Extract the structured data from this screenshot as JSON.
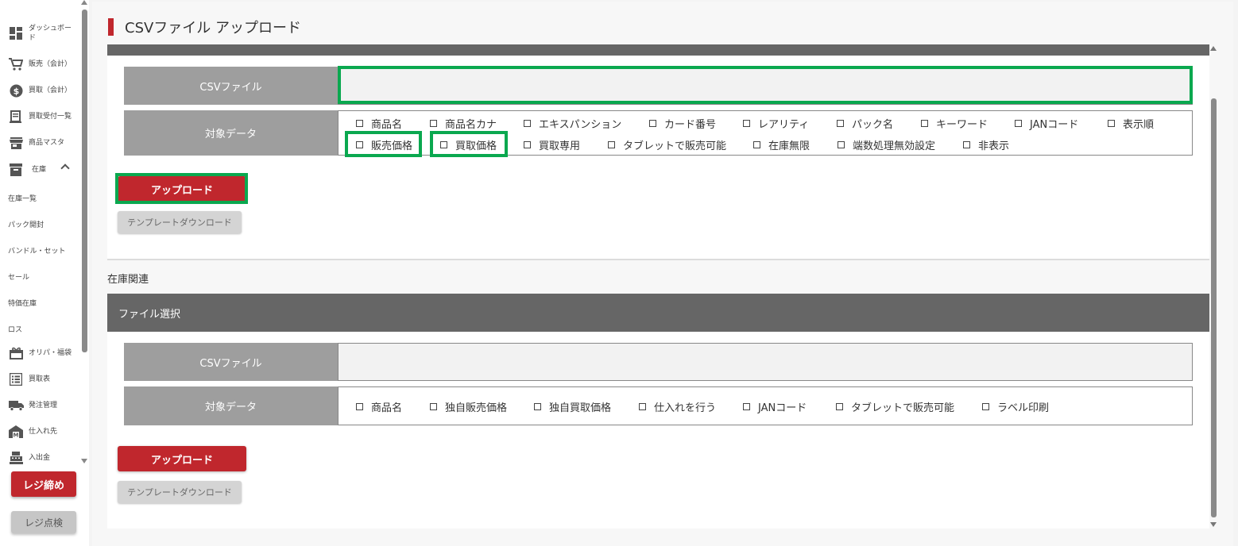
{
  "sidebar": {
    "items": [
      {
        "label": "ダッシュボード",
        "icon": "dashboard-icon"
      },
      {
        "label": "販売（会計）",
        "icon": "cart-icon"
      },
      {
        "label": "買取（会計）",
        "icon": "dollar-icon"
      },
      {
        "label": "買取受付一覧",
        "icon": "receipt-icon"
      },
      {
        "label": "商品マスタ",
        "icon": "store-icon"
      },
      {
        "label": "在庫",
        "icon": "archive-icon"
      },
      {
        "label": "オリパ・福袋",
        "icon": "gift-icon"
      },
      {
        "label": "買取表",
        "icon": "list-icon"
      },
      {
        "label": "発注管理",
        "icon": "truck-icon"
      },
      {
        "label": "仕入れ先",
        "icon": "warehouse-icon"
      },
      {
        "label": "入出金",
        "icon": "register-icon"
      }
    ],
    "subitems": [
      "在庫一覧",
      "パック開封",
      "バンドル・セット",
      "セール",
      "特価在庫",
      "ロス"
    ],
    "close_register": "レジ締め",
    "check_register": "レジ点検"
  },
  "page": {
    "title": "CSVファイル アップロード",
    "section_label": "在庫関連"
  },
  "card1": {
    "csv_label": "CSVファイル",
    "target_label": "対象データ",
    "checkboxes_row1": [
      "商品名",
      "商品名カナ",
      "エキスパンション",
      "カード番号",
      "レアリティ",
      "パック名",
      "キーワード",
      "JANコード",
      "表示順"
    ],
    "checkboxes_row2": [
      "販売価格",
      "買取価格",
      "買取専用",
      "タブレットで販売可能",
      "在庫無限",
      "端数処理無効設定",
      "非表示"
    ],
    "upload_button": "アップロード",
    "template_button": "テンプレートダウンロード"
  },
  "card2": {
    "header": "ファイル選択",
    "csv_label": "CSVファイル",
    "target_label": "対象データ",
    "checkboxes": [
      "商品名",
      "独自販売価格",
      "独自買取価格",
      "仕入れを行う",
      "JANコード",
      "タブレットで販売可能",
      "ラベル印刷"
    ],
    "upload_button": "アップロード",
    "template_button": "テンプレートダウンロード"
  },
  "colors": {
    "accent_red": "#c0272d",
    "highlight_green": "#0aa84f",
    "header_gray": "#666666",
    "label_gray": "#9e9e9e"
  }
}
